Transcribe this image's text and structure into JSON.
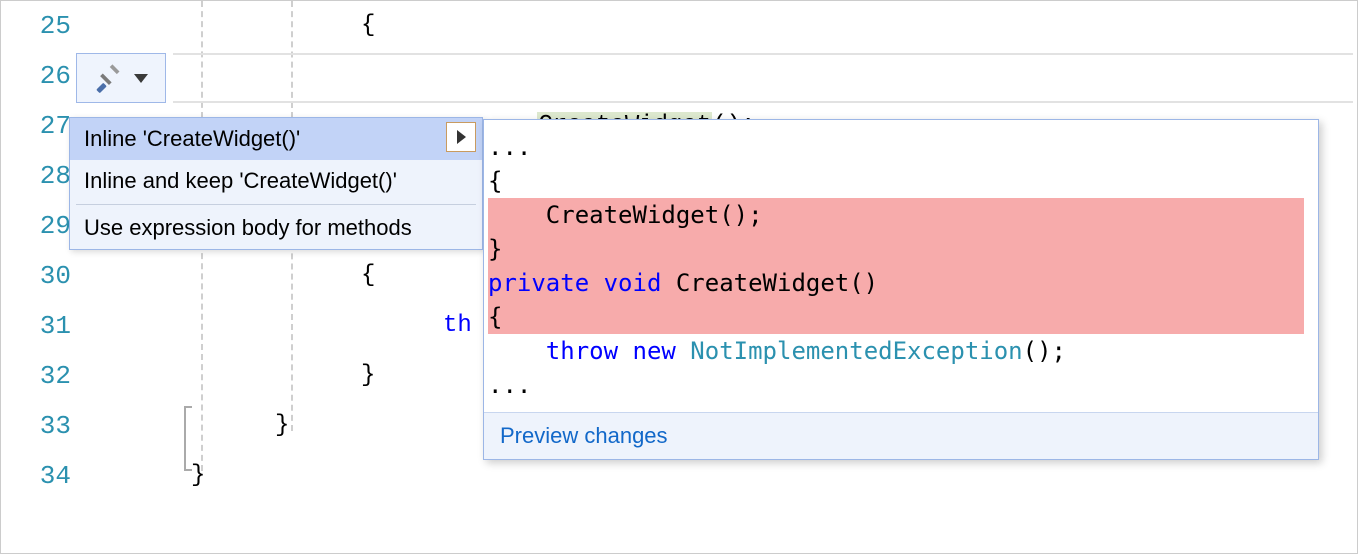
{
  "gutter": {
    "start": 25,
    "end": 34,
    "lines": [
      "25",
      "26",
      "27",
      "28",
      "29",
      "30",
      "31",
      "32",
      "33",
      "34"
    ]
  },
  "code": {
    "l25": "{",
    "l26_call": "CreateWidget",
    "l26_suffix": "();",
    "l30": "{",
    "l31_th": "th",
    "l32": "}",
    "l33": "}",
    "l34": "}"
  },
  "quickActions": {
    "items": [
      {
        "label": "Inline 'CreateWidget()'",
        "hasSubmenu": true,
        "selected": true
      },
      {
        "label": "Inline and keep 'CreateWidget()'",
        "hasSubmenu": false,
        "selected": false
      },
      {
        "label": "Use expression body for methods",
        "hasSubmenu": false,
        "selected": false
      }
    ]
  },
  "preview": {
    "ellipsis_top": "...",
    "brace_open": "{",
    "removed_1": "    CreateWidget();",
    "removed_2": "}",
    "removed_3": "",
    "removed_sig_private": "private ",
    "removed_sig_void": "void ",
    "removed_sig_name": "CreateWidget()",
    "removed_4": "{",
    "body_indent": "    ",
    "body_throw": "throw ",
    "body_new": "new ",
    "body_type": "NotImplementedException",
    "body_after": "();",
    "ellipsis_bottom": "...",
    "footer": "Preview changes"
  }
}
